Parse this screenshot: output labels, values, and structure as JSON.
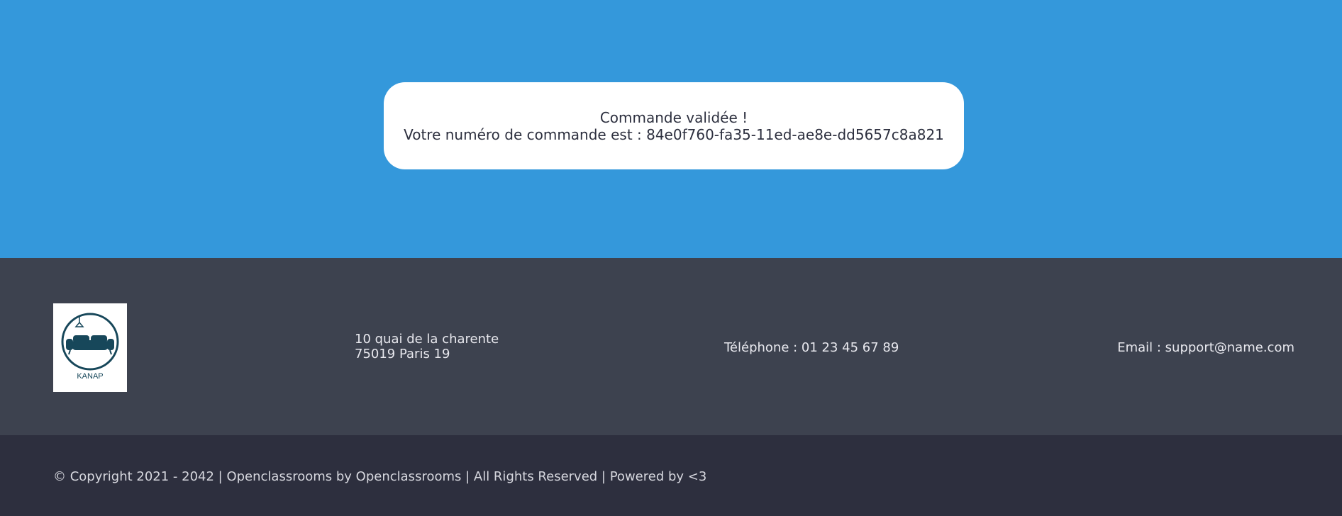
{
  "confirmation": {
    "title": "Commande validée !",
    "message": "Votre numéro de commande est : 84e0f760-fa35-11ed-ae8e-dd5657c8a821"
  },
  "footer": {
    "logo": {
      "text": "KANAP",
      "icon": "sofa-lamp-logo",
      "color": "#17475a"
    },
    "address": {
      "line1": "10 quai de la charente",
      "line2": "75019 Paris 19"
    },
    "phone": "Téléphone : 01 23 45 67 89",
    "email": "Email : support@name.com",
    "copyright": "© Copyright 2021 - 2042 | Openclassrooms by Openclassrooms | All Rights Reserved | Powered by <3"
  },
  "colors": {
    "main_bg": "#3498db",
    "footer_top_bg": "#3d424f",
    "footer_bottom_bg": "#2d2f3e",
    "card_bg": "#ffffff"
  }
}
